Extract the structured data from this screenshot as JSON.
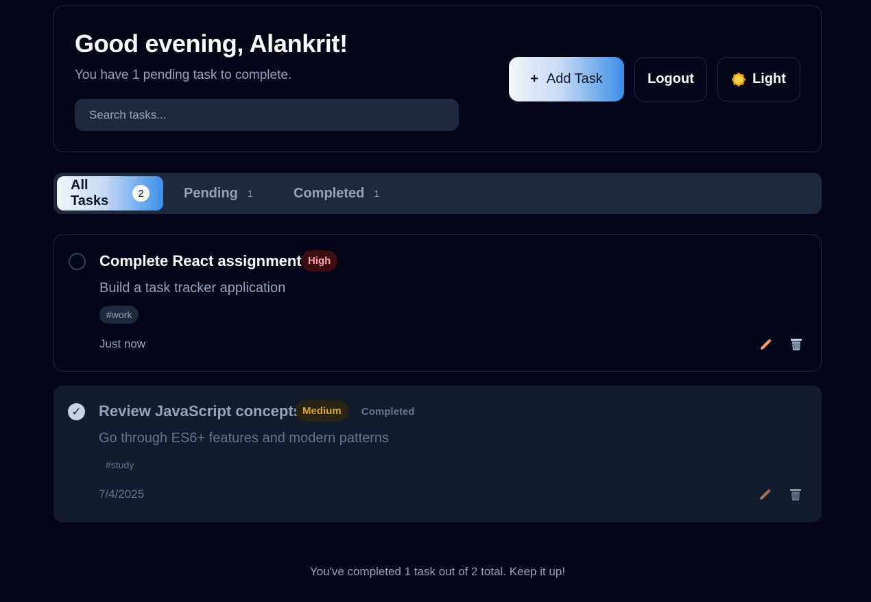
{
  "header": {
    "greeting": "Good evening, Alankrit!",
    "subtext": "You have 1 pending task to complete.",
    "search_placeholder": "Search tasks...",
    "add_task_plus": "+",
    "add_task_label": "Add Task",
    "logout_label": "Logout",
    "theme_label": "Light",
    "theme_icon": "sun-icon"
  },
  "tabs": [
    {
      "label": "All Tasks",
      "count": "2",
      "active": true
    },
    {
      "label": "Pending",
      "count": "1",
      "active": false
    },
    {
      "label": "Completed",
      "count": "1",
      "active": false
    }
  ],
  "tasks": [
    {
      "title": "Complete React assignment",
      "priority": "High",
      "description": "Build a task tracker application",
      "tag": "#work",
      "time": "Just now",
      "completed": false,
      "status_label": ""
    },
    {
      "title": "Review JavaScript concepts",
      "priority": "Medium",
      "description": "Go through ES6+ features and modern patterns",
      "tag": "#study",
      "time": "7/4/2025",
      "completed": true,
      "status_label": "Completed",
      "check_glyph": "✓"
    }
  ],
  "footer": {
    "summary": "You've completed 1 task out of 2 total. Keep it up!"
  },
  "colors": {
    "background": "#020617",
    "card_border": "#1e293b",
    "accent_gradient_end": "#3b8fe8",
    "high_priority": "#fca5a5",
    "medium_priority": "#d4a72c"
  }
}
